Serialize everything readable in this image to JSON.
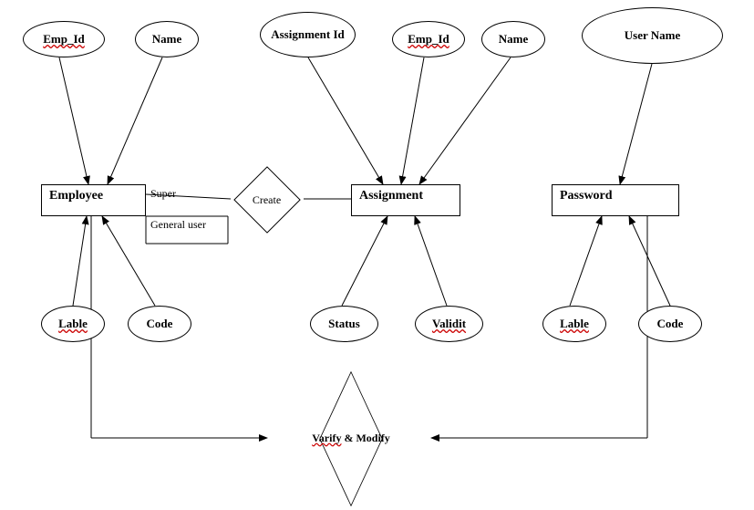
{
  "entities": {
    "employee": "Employee",
    "assignment": "Assignment",
    "password": "Password"
  },
  "attributes": {
    "emp_id_1": "Emp_Id",
    "name_1": "Name",
    "assignment_id": "Assignment Id",
    "emp_id_2": "Emp_Id",
    "name_2": "Name",
    "user_name": "User Name",
    "lable_1": "Lable",
    "code_1": "Code",
    "status": "Status",
    "validit": "Validit",
    "lable_2": "Lable",
    "code_2": "Code"
  },
  "relationships": {
    "create": "Create",
    "varify_modify": "Varify & Modify"
  },
  "labels": {
    "super": "Super",
    "general_user": "General user"
  }
}
